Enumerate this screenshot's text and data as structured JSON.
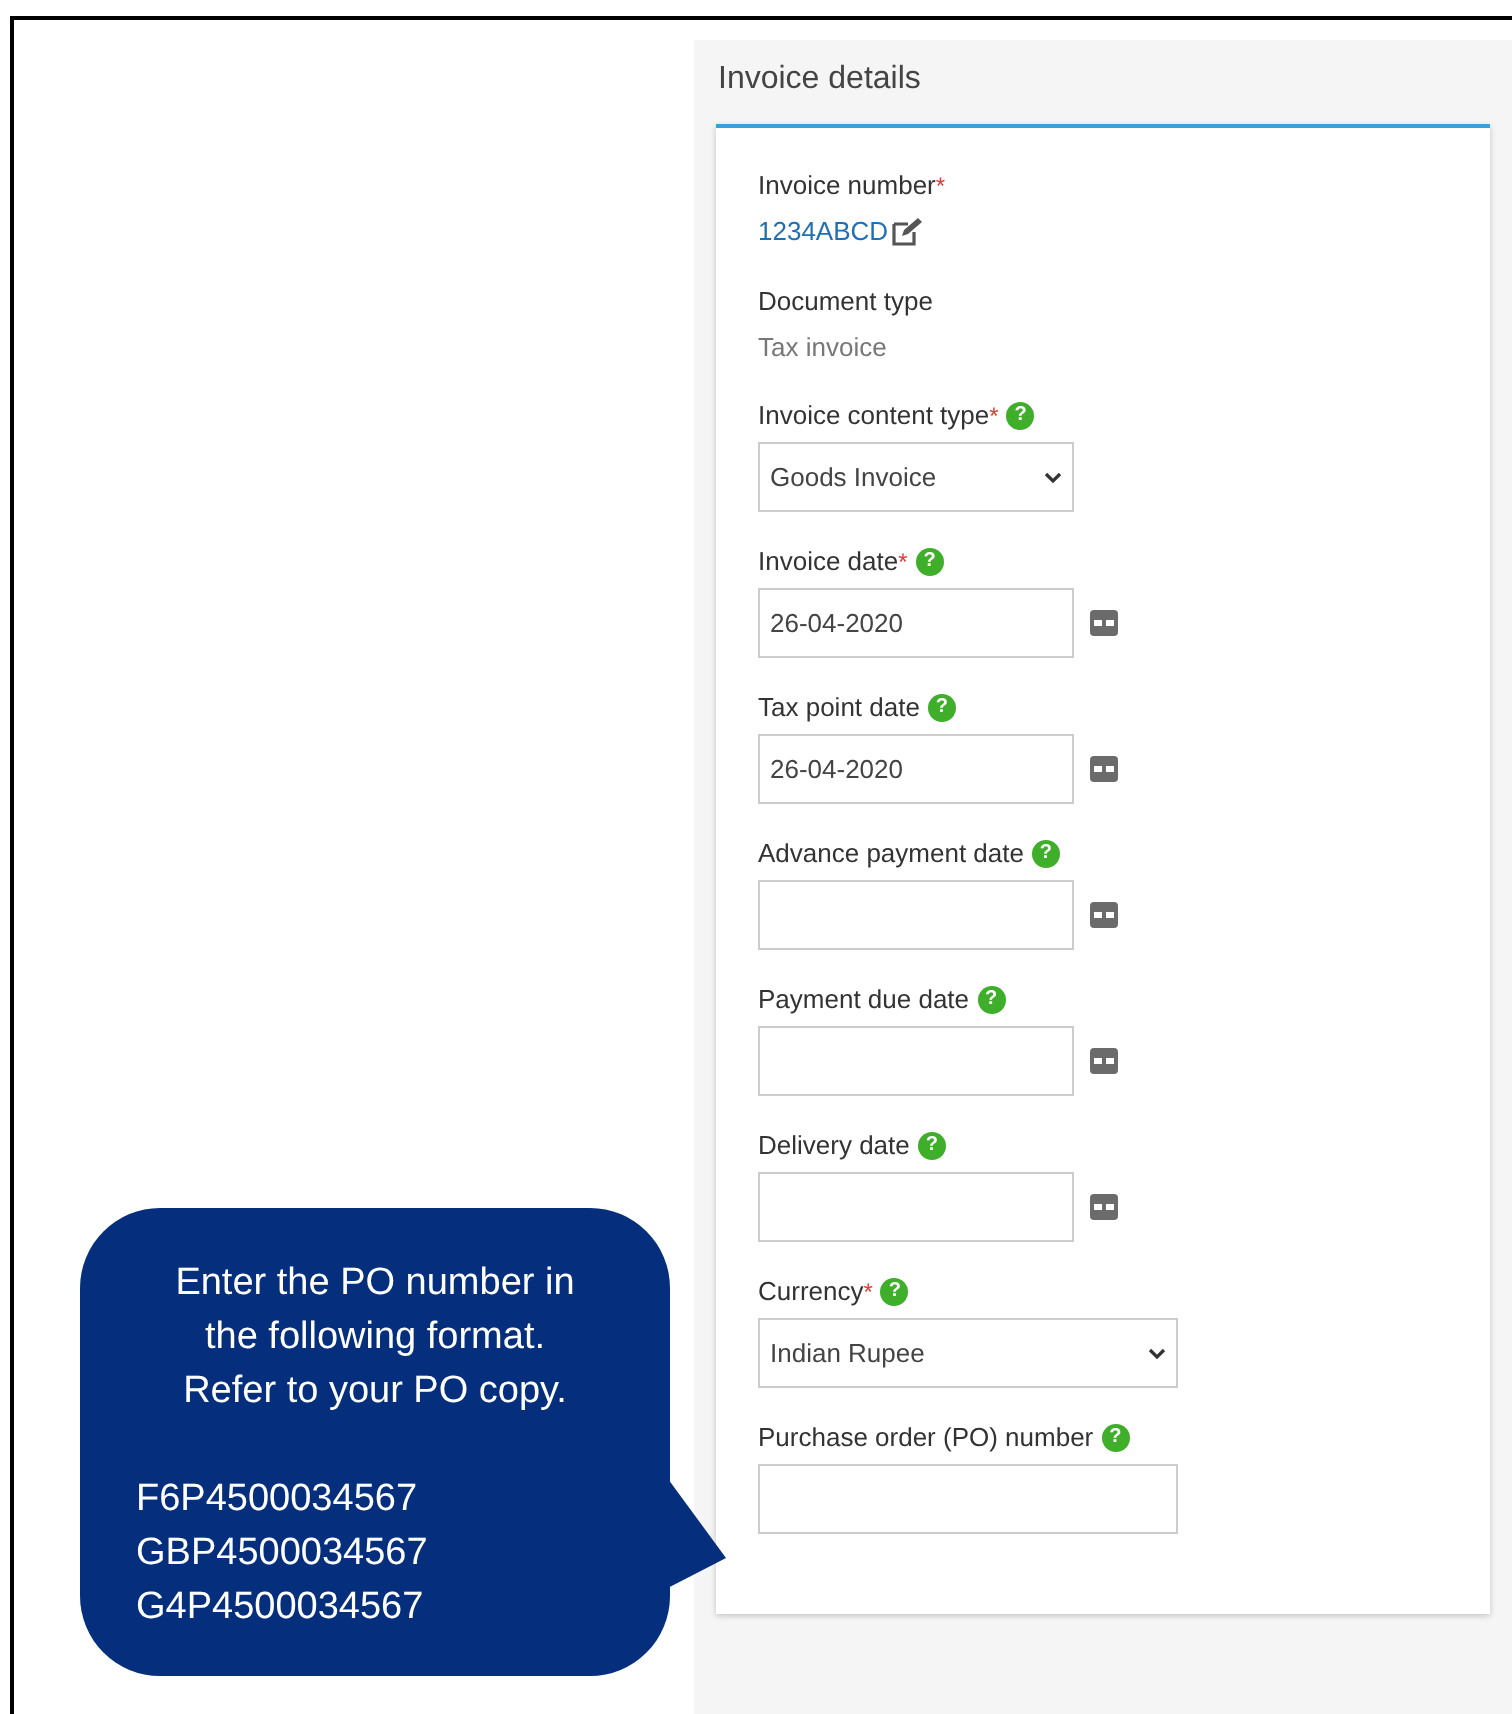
{
  "panel": {
    "title": "Invoice details"
  },
  "marks": {
    "required": "*",
    "help": "?"
  },
  "fields": [
    {
      "kind": "link",
      "label": "Invoice number",
      "required": true,
      "help": false,
      "value": "1234ABCD"
    },
    {
      "kind": "text",
      "label": "Document type",
      "required": false,
      "help": false,
      "value": "Tax invoice"
    },
    {
      "kind": "select",
      "label": "Invoice content type",
      "required": true,
      "help": true,
      "value": "Goods Invoice"
    },
    {
      "kind": "date",
      "label": "Invoice date",
      "required": true,
      "help": true,
      "value": "26-04-2020"
    },
    {
      "kind": "date",
      "label": "Tax point date",
      "required": false,
      "help": true,
      "value": "26-04-2020"
    },
    {
      "kind": "date",
      "label": "Advance payment date",
      "required": false,
      "help": true
    },
    {
      "kind": "date",
      "label": "Payment due date",
      "required": false,
      "help": true
    },
    {
      "kind": "date",
      "label": "Delivery date",
      "required": false,
      "help": true
    },
    {
      "kind": "wide-select",
      "label": "Currency",
      "required": true,
      "help": true,
      "value": "Indian Rupee"
    },
    {
      "kind": "input",
      "label": "Purchase order (PO) number",
      "required": false,
      "help": true
    }
  ],
  "callout": {
    "lines": [
      "Enter the PO number in",
      "the following format.",
      "Refer to your PO copy."
    ],
    "examples": [
      "F6P4500034567",
      "GBP4500034567",
      "G4P4500034567"
    ]
  }
}
